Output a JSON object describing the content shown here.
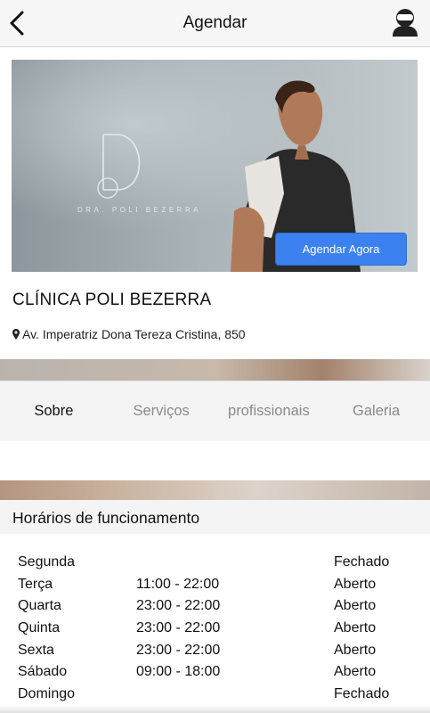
{
  "header": {
    "title": "Agendar",
    "back_icon": "chevron-left-icon",
    "profile_icon": "user-avatar-icon"
  },
  "hero": {
    "logo_text": "DRA. POLI BEZERRA",
    "book_button_label": "Agendar Agora",
    "accent_color": "#3b82f0"
  },
  "clinic": {
    "name": "CLÍNICA POLI BEZERRA",
    "address": "Av. Imperatriz Dona Tereza Cristina, 850",
    "address_icon": "map-pin-icon"
  },
  "tabs": [
    {
      "label": "Sobre",
      "active": true
    },
    {
      "label": "Serviços",
      "active": false
    },
    {
      "label": "profissionais",
      "active": false
    },
    {
      "label": "Galeria",
      "active": false
    }
  ],
  "hours": {
    "title": "Horários de funcionamento",
    "rows": [
      {
        "day": "Segunda",
        "time": "",
        "status": "Fechado"
      },
      {
        "day": "Terça",
        "time": "11:00 - 22:00",
        "status": "Aberto"
      },
      {
        "day": "Quarta",
        "time": "23:00 - 22:00",
        "status": "Aberto"
      },
      {
        "day": "Quinta",
        "time": "23:00 - 22:00",
        "status": "Aberto"
      },
      {
        "day": "Sexta",
        "time": "23:00 - 22:00",
        "status": "Aberto"
      },
      {
        "day": "Sábado",
        "time": "09:00 - 18:00",
        "status": "Aberto"
      },
      {
        "day": "Domingo",
        "time": "",
        "status": "Fechado"
      }
    ]
  }
}
